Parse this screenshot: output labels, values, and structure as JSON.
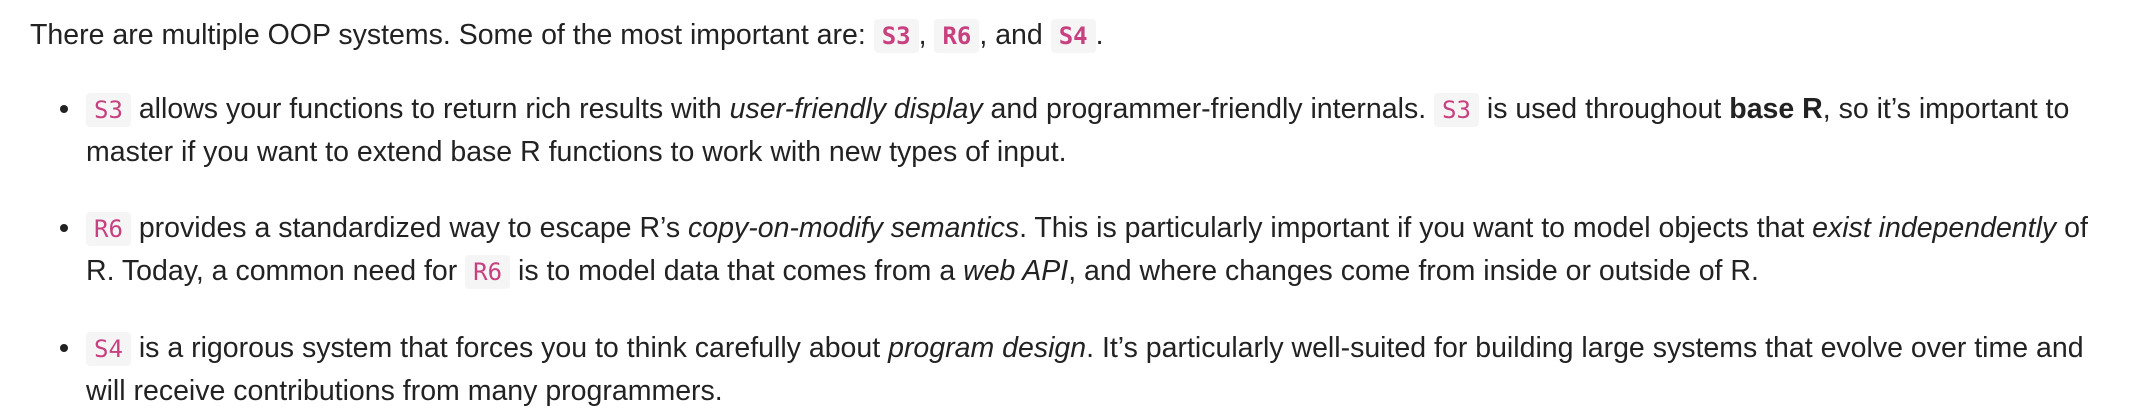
{
  "intro": {
    "t1": "There are multiple OOP systems. Some of the most important are: ",
    "c1": "S3",
    "t2": ", ",
    "c2": "R6",
    "t3": ", and ",
    "c3": "S4",
    "t4": "."
  },
  "bullets": [
    {
      "c1": "S3",
      "t1": " allows your functions to return rich results with ",
      "e1": "user-friendly display",
      "t2": " and programmer-friendly internals. ",
      "c2": "S3",
      "t3": " is used throughout ",
      "b1": "base R",
      "t4": ", so it’s important to master if you want to extend base R functions to work with new types of input."
    },
    {
      "c1": "R6",
      "t1": " provides a standardized way to escape R’s ",
      "e1": "copy-on-modify semantics",
      "t2": ". This is particularly important if you want to model objects that ",
      "e2": "exist independently",
      "t3": " of R. Today, a common need for ",
      "c2": "R6",
      "t4": " is to model data that comes from a ",
      "e3": "web API",
      "t5": ", and where changes come from inside or outside of R."
    },
    {
      "c1": "S4",
      "t1": " is a rigorous system that forces you to think carefully about ",
      "e1": "program design",
      "t2": ". It’s particularly well-suited for building large systems that evolve over time and will receive contributions from many programmers."
    }
  ]
}
